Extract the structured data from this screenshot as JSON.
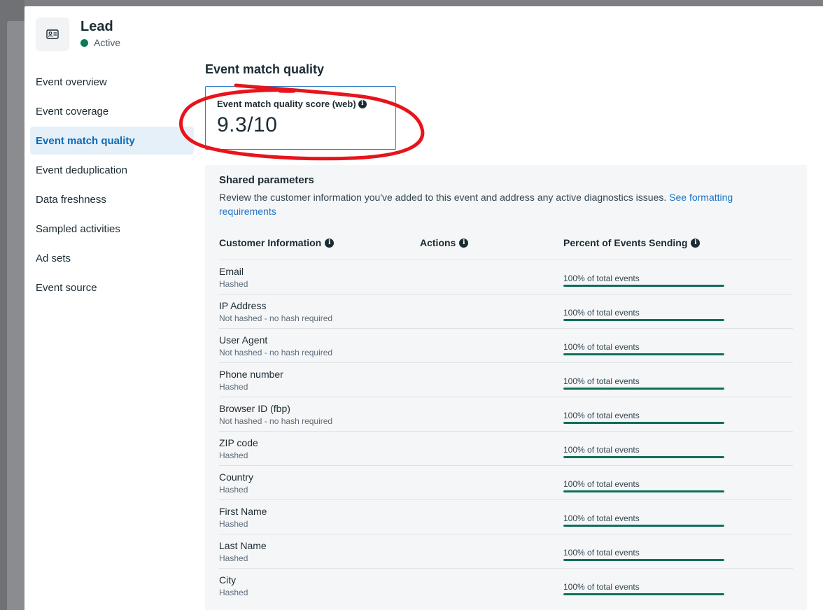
{
  "header": {
    "title": "Lead",
    "status": "Active",
    "status_color": "#0a7b59",
    "icon": "id-card-icon"
  },
  "sidebar": {
    "items": [
      {
        "label": "Event overview",
        "active": false
      },
      {
        "label": "Event coverage",
        "active": false
      },
      {
        "label": "Event match quality",
        "active": true
      },
      {
        "label": "Event deduplication",
        "active": false
      },
      {
        "label": "Data freshness",
        "active": false
      },
      {
        "label": "Sampled activities",
        "active": false
      },
      {
        "label": "Ad sets",
        "active": false
      },
      {
        "label": "Event source",
        "active": false
      }
    ]
  },
  "main": {
    "title": "Event match quality",
    "score": {
      "label": "Event match quality score (web)",
      "value": "9.3/10"
    },
    "shared": {
      "title": "Shared parameters",
      "description": "Review the customer information you've added to this event and address any active diagnostics issues.",
      "link": "See formatting requirements",
      "columns": [
        "Customer Information",
        "Actions",
        "Percent of Events Sending"
      ],
      "rows": [
        {
          "name": "Email",
          "sub": "Hashed",
          "pct_label": "100% of total events",
          "pct": 100
        },
        {
          "name": "IP Address",
          "sub": "Not hashed - no hash required",
          "pct_label": "100% of total events",
          "pct": 100
        },
        {
          "name": "User Agent",
          "sub": "Not hashed - no hash required",
          "pct_label": "100% of total events",
          "pct": 100
        },
        {
          "name": "Phone number",
          "sub": "Hashed",
          "pct_label": "100% of total events",
          "pct": 100
        },
        {
          "name": "Browser ID (fbp)",
          "sub": "Not hashed - no hash required",
          "pct_label": "100% of total events",
          "pct": 100
        },
        {
          "name": "ZIP code",
          "sub": "Hashed",
          "pct_label": "100% of total events",
          "pct": 100
        },
        {
          "name": "Country",
          "sub": "Hashed",
          "pct_label": "100% of total events",
          "pct": 100
        },
        {
          "name": "First Name",
          "sub": "Hashed",
          "pct_label": "100% of total events",
          "pct": 100
        },
        {
          "name": "Last Name",
          "sub": "Hashed",
          "pct_label": "100% of total events",
          "pct": 100
        },
        {
          "name": "City",
          "sub": "Hashed",
          "pct_label": "100% of total events",
          "pct": 100
        }
      ]
    }
  },
  "colors": {
    "accent": "#0b6bb8",
    "bar": "#0f6e5a",
    "annotation": "#e8141b"
  }
}
